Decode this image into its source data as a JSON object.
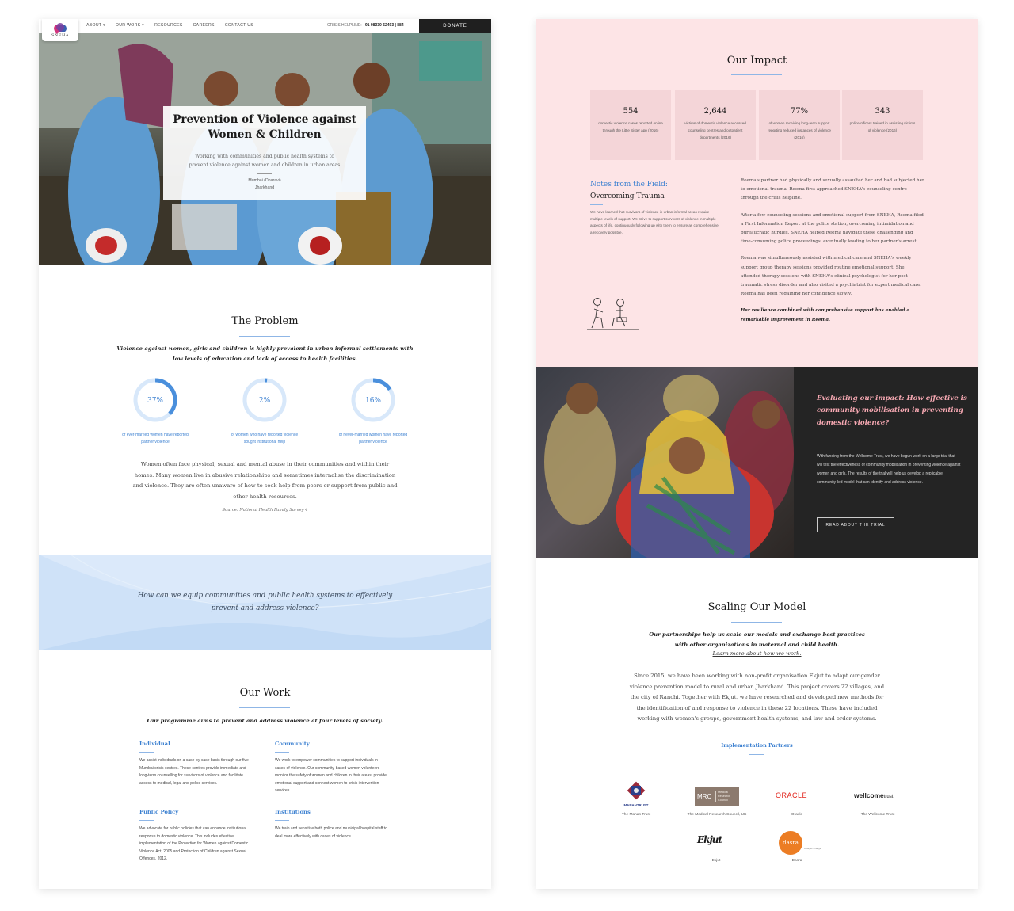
{
  "nav": {
    "logo_text": "SNEHA",
    "items": [
      "ABOUT ▾",
      "OUR WORK ▾",
      "RESOURCES",
      "CAREERS",
      "CONTACT US"
    ],
    "helpline_label": "CRISIS HELPLINE:",
    "helpline_number": "+91 98330 52493 | 884",
    "donate_label": "DONATE"
  },
  "hero": {
    "title_line1": "Prevention of Violence against",
    "title_line2": "Women & Children",
    "subtitle": "Working with communities and public health systems to prevent violence against women and children in urban areas",
    "location_line1": "Mumbai (Dharavi)",
    "location_line2": "Jharkhand"
  },
  "problem": {
    "title": "The Problem",
    "lead_line1": "Violence against women, girls and children is highly prevalent in urban informal settlements with",
    "lead_line2": "low levels of education and lack of access to health facilities.",
    "stats": [
      {
        "value": "37%",
        "percent": 37,
        "label_line1": "of ever-married women have reported",
        "label_line2": "partner violence"
      },
      {
        "value": "2%",
        "percent": 2,
        "label_line1": "of women who have reported violence",
        "label_line2": "sought institutional help"
      },
      {
        "value": "16%",
        "percent": 16,
        "label_line1": "of never-married women have reported",
        "label_line2": "partner violence"
      }
    ],
    "body": "Women often face physical, sexual and mental abuse in their communities and within their homes. Many women live in abusive relationships and sometimes internalise the discrimination and violence. They are often unaware of how to seek help from peers or support from public and other health resources.",
    "source": "Source: National Health Family Survey 4"
  },
  "banner": {
    "line1": "How can we equip communities and public health systems to effectively",
    "line2": "prevent and address violence?"
  },
  "work": {
    "title": "Our Work",
    "lead": "Our programme aims to prevent and address violence at four levels of society.",
    "cols": [
      {
        "title": "Individual",
        "text": "We assist individuals on a case-by-case basis through our five Mumbai crisis centres. These centres provide immediate and long-term counselling for survivors of violence and facilitate access to medical, legal and police services."
      },
      {
        "title": "Community",
        "text": "We work to empower communities to support individuals in cases of violence. Our community-based women volunteers monitor the safety of women and children in their areas, provide emotional support and connect women to crisis intervention services."
      },
      {
        "title": "Public Policy",
        "text": "We advocate for public policies that can enhance institutional response to domestic violence. This includes effective implementation of the Protection for Women against Domestic Violence Act, 2005 and Protection of Children against Sexual Offences, 2012."
      },
      {
        "title": "Institutions",
        "text": "We train and sensitize both police and municipal hospital staff to deal more effectively with cases of violence."
      }
    ]
  },
  "impact": {
    "title": "Our Impact",
    "stats": [
      {
        "value": "554",
        "desc": "domestic violence cases reported online through the Little Sister app (2016)"
      },
      {
        "value": "2,644",
        "desc": "victims of domestic violence accessed counseling centres and outpatient departments (2016)"
      },
      {
        "value": "77%",
        "desc": "of women receiving long-term support reporting reduced instances of violence (2016)"
      },
      {
        "value": "343",
        "desc": "police officers trained in assisting victims of violence (2016)"
      }
    ]
  },
  "notes": {
    "title_blue": "Notes from the Field:",
    "title_dark": "Overcoming Trauma",
    "text": "We have learned that survivors of violence in urban informal areas require multiple levels of support. We strive to support survivors of violence in multiple aspects of life, continuously following up with them to ensure as comprehensive a recovery possible.",
    "story": [
      "Reema's partner had physically and sexually assaulted her and had subjected her to emotional trauma. Reema first approached SNEHA's counseling centre through the crisis helpline.",
      "After a few counseling sessions and emotional support from SNEHA, Reema filed a First Information Report at the police station, overcoming intimidation and bureaucratic hurdles. SNEHA helped Reema navigate these challenging and time-consuming police proceedings, eventually leading to her partner's arrest.",
      "Reema was simultaneously assisted with medical care and SNEHA's weekly support group therapy sessions provided routine emotional support. She attended therapy sessions with SNEHA's clinical psychologist for her post-traumatic stress disorder and also visited a psychiatrist for expert medical care. Reema has been regaining her confidence slowly.",
      "Her resilience combined with comprehensive support has enabled a remarkable improvement in Reema."
    ]
  },
  "evaluation": {
    "title": "Evaluating our impact: How effective is community mobilisation in preventing domestic violence?",
    "text": "With funding from the Wellcome Trust, we have begun work on a large trial that will test the effectiveness of community mobilisation in preventing violence against women and girls. The results of the trial will help us develop a replicable, community-led model that can identify and address violence.",
    "button": "READ ABOUT THE TRIAL"
  },
  "scaling": {
    "title": "Scaling Our Model",
    "lead_line1": "Our partnerships help us scale our models and exchange best practices",
    "lead_line2": "with other organizations in maternal and child health.",
    "link": "Learn more about how we work.",
    "body": "Since 2015, we have been working with non-profit organisation Ekjut to adapt our gender violence prevention model to rural and urban Jharkhand. This project covers 22 villages, and the city of Ranchi. Together with Ekjut, we have researched and developed new methods for the identification of and response to violence in these 22 locations. These have included working with women's groups, government health systems, and law and order systems.",
    "partners_heading": "Implementation Partners",
    "partners": [
      {
        "logo": "MANANTRUST",
        "name": "The Manan Trust"
      },
      {
        "logo": "MRC",
        "logo_sub": "Medical Research Council",
        "name": "The Medical Research Council, UK"
      },
      {
        "logo": "ORACLE",
        "name": "Oracle"
      },
      {
        "logo": "wellcome",
        "logo_suffix": "trust",
        "name": "The Wellcome Trust"
      },
      {
        "logo": "Ekjut",
        "name": "Ekjut"
      },
      {
        "logo": "dasra",
        "logo_sub": "catalytic change",
        "name": "Dasra"
      }
    ]
  },
  "colors": {
    "accent_blue": "#3a7fd0",
    "impact_pink": "#fde4e6",
    "eval_pink": "#f6a8b2",
    "dark": "#242424",
    "banner_blue": "#cfe2f8"
  }
}
